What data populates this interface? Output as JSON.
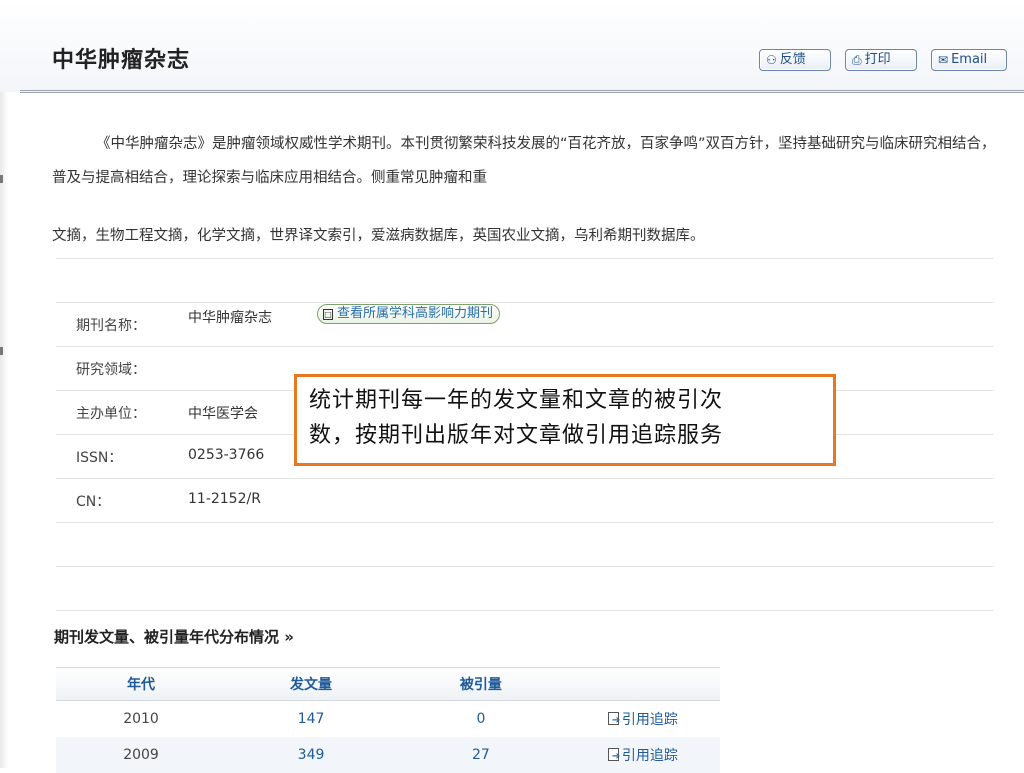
{
  "header": {
    "title": "中华肿瘤杂志",
    "buttons": [
      {
        "label": "反馈",
        "icon": "person-icon"
      },
      {
        "label": "打印",
        "icon": "printer-icon"
      },
      {
        "label": "Email",
        "icon": "envelope-icon"
      }
    ]
  },
  "intro": {
    "para": "《中华肿瘤杂志》是肿瘤领域权威性学术期刊。本刊贯彻繁荣科技发展的“百花齐放，百家争鸣”双百方针，坚持基础研究与临床研究相结合，普及与提高相结合，理论探索与临床应用相结合。侧重常见肿瘤和重",
    "line3": "文摘，生物工程文摘，化学文摘，世界译文索引，爱滋病数据库，英国农业文摘，乌利希期刊数据库。"
  },
  "info": {
    "rows": [
      {
        "label": "期刊名称：",
        "value": "中华肿瘤杂志"
      },
      {
        "label": "研究领域：",
        "value": ""
      },
      {
        "label": "主办单位：",
        "value": "中华医学会"
      },
      {
        "label": "ISSN：",
        "value": "0253-3766"
      },
      {
        "label": "CN：",
        "value": "11-2152/R"
      }
    ],
    "subject_button": "查看所属学科高影响力期刊"
  },
  "callout": {
    "line1": "统计期刊每一年的发文量和文章的被引次",
    "line2": "数，按期刊出版年对文章做引用追踪服务"
  },
  "stats": {
    "title": "期刊发文量、被引量年代分布情况 »",
    "columns": [
      "年代",
      "发文量",
      "被引量",
      ""
    ],
    "rows": [
      {
        "year": "2010",
        "articles": "147",
        "citations": "0",
        "action": "引用追踪"
      },
      {
        "year": "2009",
        "articles": "349",
        "citations": "27",
        "action": "引用追踪"
      }
    ]
  },
  "colors": {
    "accent_blue": "#1f5a99",
    "callout_border": "#e87722",
    "header_bg": "#f3f5f9"
  }
}
